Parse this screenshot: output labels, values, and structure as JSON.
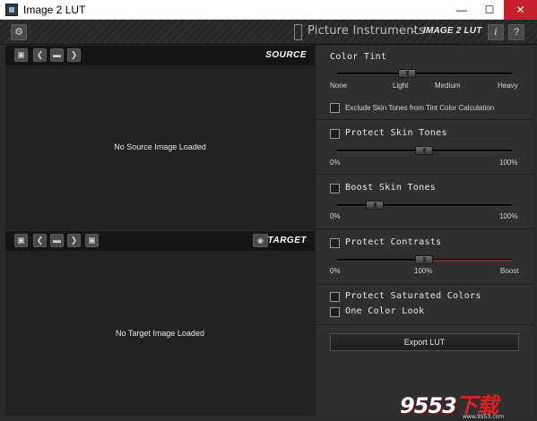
{
  "window": {
    "title": "Image 2 LUT",
    "minimize": "—",
    "maximize": "☐",
    "close": "✕"
  },
  "header": {
    "settings_icon": "gear-icon",
    "brand_name": "Picture Instruments",
    "brand_sep": "-",
    "product": "IMAGE 2 LUT",
    "info_label": "i",
    "help_label": "?"
  },
  "source": {
    "label": "SOURCE",
    "empty_message": "No Source Image Loaded",
    "toolbar_icons": [
      "save-icon",
      "chevron-left-icon",
      "folder-icon",
      "chevron-right-icon"
    ]
  },
  "target": {
    "label": "TARGET",
    "empty_message": "No Target Image Loaded",
    "toolbar_icons": [
      "save-icon",
      "chevron-left-icon",
      "folder-icon",
      "chevron-right-icon",
      "save-icon",
      "eye-icon"
    ]
  },
  "controls": {
    "color_tint": {
      "title": "Color Tint",
      "ticks": [
        "None",
        "Light",
        "Medium",
        "Heavy"
      ],
      "value": "Light",
      "exclude_label": "Exclude Skin Tones from Tint Color Calculation",
      "exclude_checked": false
    },
    "protect_skin": {
      "title": "Protect Skin Tones",
      "checked": false,
      "min_label": "0%",
      "max_label": "100%",
      "value_fraction": 0.5
    },
    "boost_skin": {
      "title": "Boost Skin Tones",
      "checked": false,
      "min_label": "0%",
      "max_label": "100%",
      "value_fraction": 0.2
    },
    "protect_contrasts": {
      "title": "Protect Contrasts",
      "checked": false,
      "min_label": "0%",
      "mid_label": "100%",
      "max_label": "Boost",
      "value_label": "100%"
    },
    "protect_saturated": {
      "title": "Protect Saturated Colors",
      "checked": false
    },
    "one_color_look": {
      "title": "One Color Look",
      "checked": false
    },
    "export_label": "Export LUT"
  },
  "watermark": {
    "text_white": "9553",
    "text_red": "下载",
    "sub": "www.9553.com"
  },
  "colors": {
    "accent_track": "#7a2a1a",
    "panel_bg": "#2f2f2f",
    "image_bg": "#222222",
    "close_btn": "#c8202c"
  }
}
